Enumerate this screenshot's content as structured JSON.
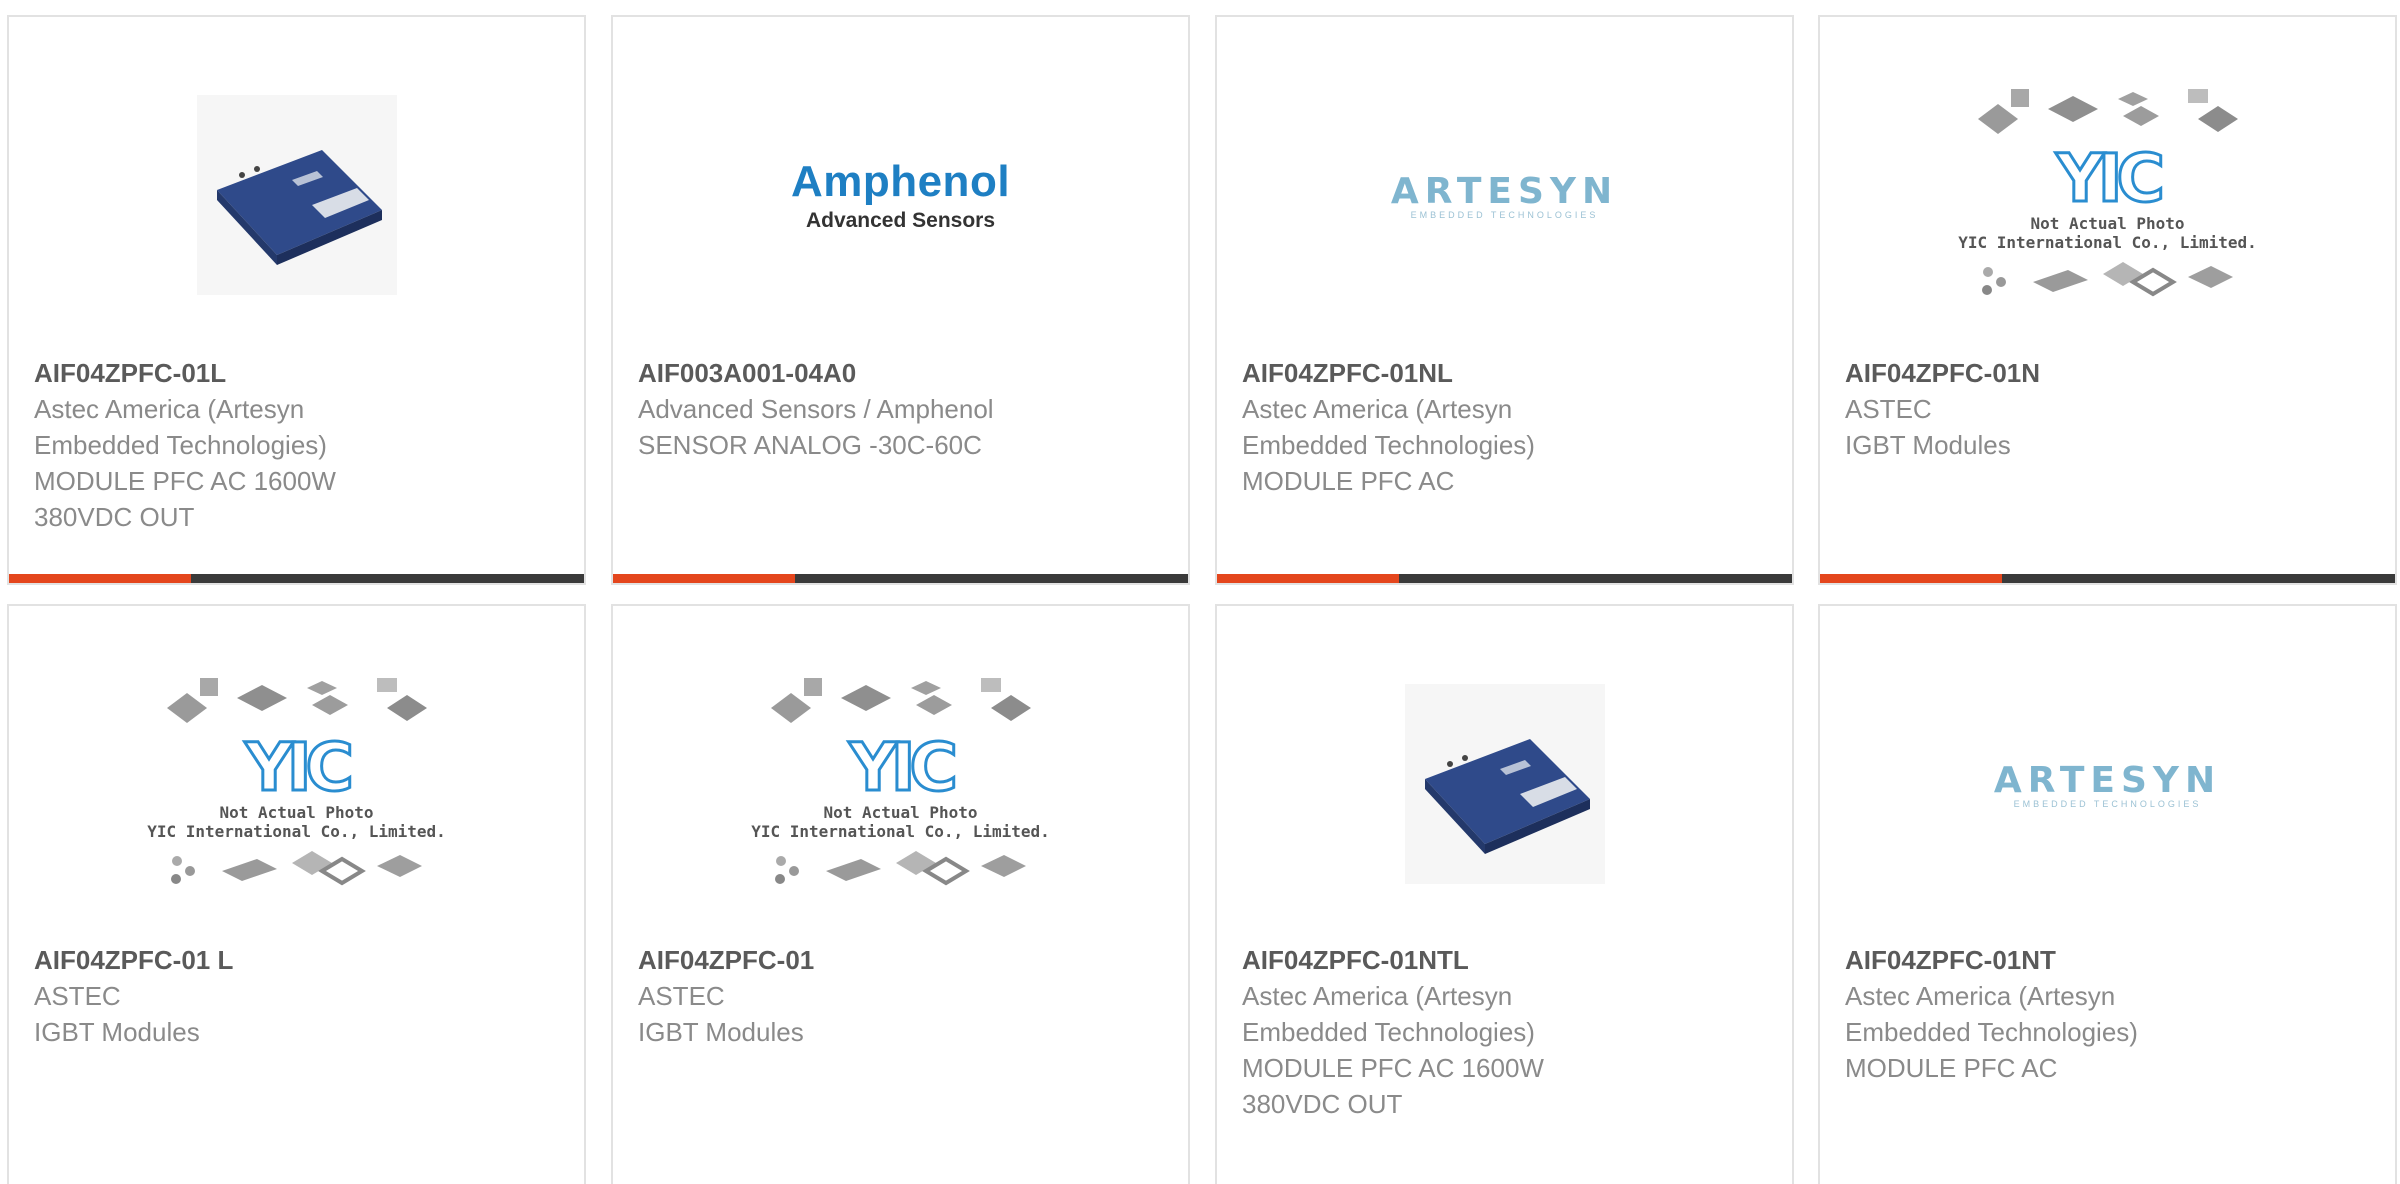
{
  "products": [
    {
      "part": "AIF04ZPFC-01L",
      "lines": [
        "Astec America (Artesyn",
        "Embedded Technologies)",
        "MODULE PFC AC 1600W",
        "380VDC OUT"
      ],
      "image": "module-photo",
      "accent_bar": true
    },
    {
      "part": "AIF003A001-04A0",
      "lines": [
        "Advanced Sensors / Amphenol",
        "SENSOR ANALOG -30C-60C"
      ],
      "image": "amphenol-logo",
      "accent_bar": true
    },
    {
      "part": "AIF04ZPFC-01NL",
      "lines": [
        "Astec America (Artesyn",
        "Embedded Technologies)",
        "MODULE PFC AC"
      ],
      "image": "artesyn-logo",
      "accent_bar": true
    },
    {
      "part": "AIF04ZPFC-01N",
      "lines": [
        "ASTEC",
        "IGBT Modules"
      ],
      "image": "yic-placeholder",
      "accent_bar": true
    },
    {
      "part": "AIF04ZPFC-01 L",
      "lines": [
        "ASTEC",
        "IGBT Modules"
      ],
      "image": "yic-placeholder",
      "accent_bar": false
    },
    {
      "part": "AIF04ZPFC-01",
      "lines": [
        "ASTEC",
        "IGBT Modules"
      ],
      "image": "yic-placeholder",
      "accent_bar": false
    },
    {
      "part": "AIF04ZPFC-01NTL",
      "lines": [
        "Astec America (Artesyn",
        "Embedded Technologies)",
        "MODULE PFC AC 1600W",
        "380VDC OUT"
      ],
      "image": "module-photo",
      "accent_bar": false
    },
    {
      "part": "AIF04ZPFC-01NT",
      "lines": [
        "Astec America (Artesyn",
        "Embedded Technologies)",
        "MODULE PFC AC"
      ],
      "image": "artesyn-logo",
      "accent_bar": false
    }
  ],
  "logos": {
    "amphenol": {
      "name": "Amphenol",
      "sub": "Advanced Sensors"
    },
    "artesyn": {
      "name": "ARTESYN",
      "sub": "EMBEDDED TECHNOLOGIES"
    },
    "yic": {
      "mark": "YIC",
      "line1": "Not Actual Photo",
      "line2": "YIC International Co., Limited."
    }
  },
  "colors": {
    "accent": "#e4461d",
    "bar": "#3a3a3a",
    "border": "#e2e2e2",
    "part_text": "#5a5a5a",
    "body_text": "#8a8a8a",
    "module_blue": "#2f4a8a"
  }
}
